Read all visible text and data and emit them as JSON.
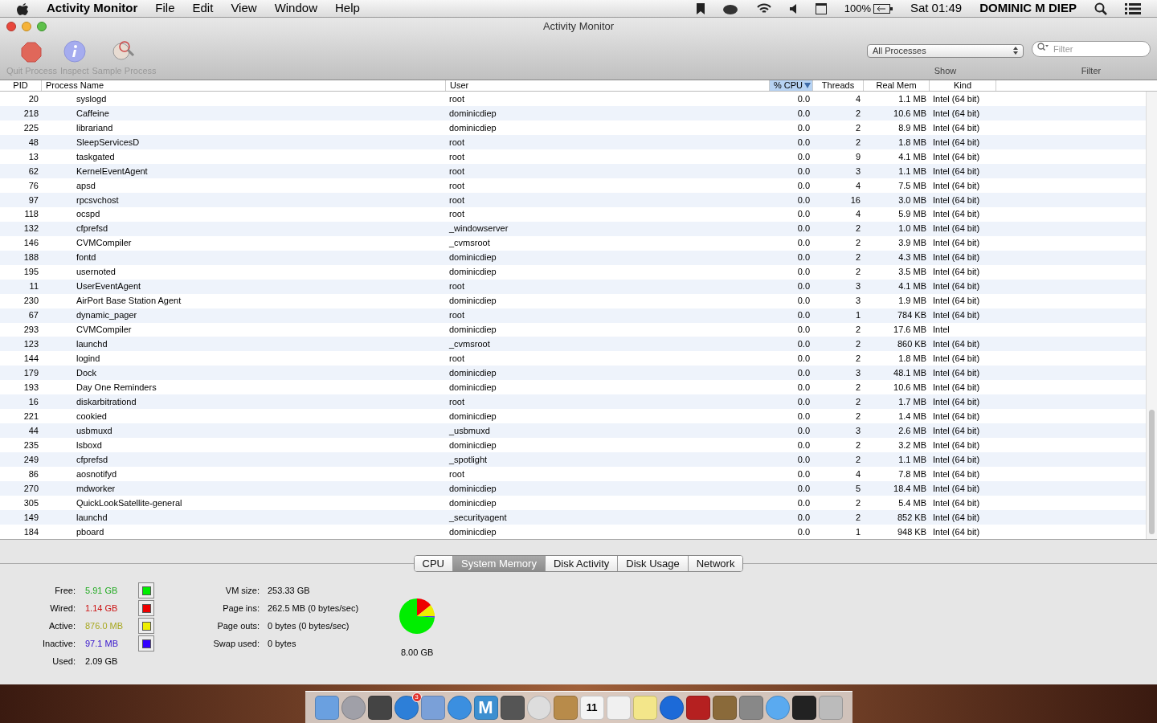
{
  "menu_bar": {
    "app": "Activity Monitor",
    "items": [
      "File",
      "Edit",
      "View",
      "Window",
      "Help"
    ],
    "battery": "100%",
    "clock": "Sat 01:49",
    "user": "DOMINIC M DIEP"
  },
  "window": {
    "title": "Activity Monitor"
  },
  "toolbar": {
    "buttons": [
      {
        "kind": "quit",
        "label": "Quit Process",
        "disabled": true
      },
      {
        "kind": "inspect",
        "label": "Inspect",
        "disabled": true
      },
      {
        "kind": "sample",
        "label": "Sample Process",
        "disabled": true
      }
    ],
    "show": {
      "value": "All Processes",
      "label": "Show"
    },
    "filter": {
      "placeholder": "Filter",
      "label": "Filter"
    }
  },
  "table": {
    "columns": [
      {
        "label": "PID",
        "sorted": false
      },
      {
        "label": "Process Name",
        "sorted": false
      },
      {
        "label": "User",
        "sorted": false
      },
      {
        "label": "% CPU",
        "sorted": true
      },
      {
        "label": "Threads",
        "sorted": false
      },
      {
        "label": "Real Mem",
        "sorted": false
      },
      {
        "label": "Kind",
        "sorted": false
      }
    ],
    "rows": [
      [
        "20",
        "syslogd",
        "root",
        "0.0",
        "4",
        "1.1 MB",
        "Intel (64 bit)"
      ],
      [
        "218",
        "Caffeine",
        "dominicdiep",
        "0.0",
        "2",
        "10.6 MB",
        "Intel (64 bit)"
      ],
      [
        "225",
        "librariand",
        "dominicdiep",
        "0.0",
        "2",
        "8.9 MB",
        "Intel (64 bit)"
      ],
      [
        "48",
        "SleepServicesD",
        "root",
        "0.0",
        "2",
        "1.8 MB",
        "Intel (64 bit)"
      ],
      [
        "13",
        "taskgated",
        "root",
        "0.0",
        "9",
        "4.1 MB",
        "Intel (64 bit)"
      ],
      [
        "62",
        "KernelEventAgent",
        "root",
        "0.0",
        "3",
        "1.1 MB",
        "Intel (64 bit)"
      ],
      [
        "76",
        "apsd",
        "root",
        "0.0",
        "4",
        "7.5 MB",
        "Intel (64 bit)"
      ],
      [
        "97",
        "rpcsvchost",
        "root",
        "0.0",
        "16",
        "3.0 MB",
        "Intel (64 bit)"
      ],
      [
        "118",
        "ocspd",
        "root",
        "0.0",
        "4",
        "5.9 MB",
        "Intel (64 bit)"
      ],
      [
        "132",
        "cfprefsd",
        "_windowserver",
        "0.0",
        "2",
        "1.0 MB",
        "Intel (64 bit)"
      ],
      [
        "146",
        "CVMCompiler",
        "_cvmsroot",
        "0.0",
        "2",
        "3.9 MB",
        "Intel (64 bit)"
      ],
      [
        "188",
        "fontd",
        "dominicdiep",
        "0.0",
        "2",
        "4.3 MB",
        "Intel (64 bit)"
      ],
      [
        "195",
        "usernoted",
        "dominicdiep",
        "0.0",
        "2",
        "3.5 MB",
        "Intel (64 bit)"
      ],
      [
        "11",
        "UserEventAgent",
        "root",
        "0.0",
        "3",
        "4.1 MB",
        "Intel (64 bit)"
      ],
      [
        "230",
        "AirPort Base Station Agent",
        "dominicdiep",
        "0.0",
        "3",
        "1.9 MB",
        "Intel (64 bit)"
      ],
      [
        "67",
        "dynamic_pager",
        "root",
        "0.0",
        "1",
        "784 KB",
        "Intel (64 bit)"
      ],
      [
        "293",
        "CVMCompiler",
        "dominicdiep",
        "0.0",
        "2",
        "17.6 MB",
        "Intel"
      ],
      [
        "123",
        "launchd",
        "_cvmsroot",
        "0.0",
        "2",
        "860 KB",
        "Intel (64 bit)"
      ],
      [
        "144",
        "logind",
        "root",
        "0.0",
        "2",
        "1.8 MB",
        "Intel (64 bit)"
      ],
      [
        "179",
        "Dock",
        "dominicdiep",
        "0.0",
        "3",
        "48.1 MB",
        "Intel (64 bit)"
      ],
      [
        "193",
        "Day One Reminders",
        "dominicdiep",
        "0.0",
        "2",
        "10.6 MB",
        "Intel (64 bit)"
      ],
      [
        "16",
        "diskarbitrationd",
        "root",
        "0.0",
        "2",
        "1.7 MB",
        "Intel (64 bit)"
      ],
      [
        "221",
        "cookied",
        "dominicdiep",
        "0.0",
        "2",
        "1.4 MB",
        "Intel (64 bit)"
      ],
      [
        "44",
        "usbmuxd",
        "_usbmuxd",
        "0.0",
        "3",
        "2.6 MB",
        "Intel (64 bit)"
      ],
      [
        "235",
        "lsboxd",
        "dominicdiep",
        "0.0",
        "2",
        "3.2 MB",
        "Intel (64 bit)"
      ],
      [
        "249",
        "cfprefsd",
        "_spotlight",
        "0.0",
        "2",
        "1.1 MB",
        "Intel (64 bit)"
      ],
      [
        "86",
        "aosnotifyd",
        "root",
        "0.0",
        "4",
        "7.8 MB",
        "Intel (64 bit)"
      ],
      [
        "270",
        "mdworker",
        "dominicdiep",
        "0.0",
        "5",
        "18.4 MB",
        "Intel (64 bit)"
      ],
      [
        "305",
        "QuickLookSatellite-general",
        "dominicdiep",
        "0.0",
        "2",
        "5.4 MB",
        "Intel (64 bit)"
      ],
      [
        "149",
        "launchd",
        "_securityagent",
        "0.0",
        "2",
        "852 KB",
        "Intel (64 bit)"
      ],
      [
        "184",
        "pboard",
        "dominicdiep",
        "0.0",
        "1",
        "948 KB",
        "Intel (64 bit)"
      ]
    ]
  },
  "tabs": [
    {
      "label": "CPU",
      "selected": false
    },
    {
      "label": "System Memory",
      "selected": true
    },
    {
      "label": "Disk Activity",
      "selected": false
    },
    {
      "label": "Disk Usage",
      "selected": false
    },
    {
      "label": "Network",
      "selected": false
    }
  ],
  "memory": {
    "legend": [
      {
        "label": "Free:",
        "value": "5.91 GB",
        "color": "#00ee00"
      },
      {
        "label": "Wired:",
        "value": "1.14 GB",
        "color": "#ee0000"
      },
      {
        "label": "Active:",
        "value": "876.0 MB",
        "color": "#eeee00"
      },
      {
        "label": "Inactive:",
        "value": "97.1 MB",
        "color": "#3300ff"
      }
    ],
    "used": {
      "label": "Used:",
      "value": "2.09 GB"
    },
    "stats": [
      {
        "label": "VM size:",
        "value": "253.33 GB"
      },
      {
        "label": "Page ins:",
        "value": "262.5 MB (0 bytes/sec)"
      },
      {
        "label": "Page outs:",
        "value": "0 bytes (0 bytes/sec)"
      },
      {
        "label": "Swap used:",
        "value": "0 bytes"
      }
    ],
    "total": "8.00 GB",
    "chart_data": {
      "type": "pie",
      "values": [
        14.2,
        10.9,
        1.2,
        73.7
      ]
    }
  },
  "dock": [
    {
      "kind": "finder"
    },
    {
      "kind": "rocket"
    },
    {
      "kind": "dashboard"
    },
    {
      "kind": "appstore",
      "badge": "3"
    },
    {
      "kind": "bird"
    },
    {
      "kind": "compass"
    },
    {
      "kind": "letter",
      "text": "M"
    },
    {
      "kind": "camera"
    },
    {
      "kind": "chrome"
    },
    {
      "kind": "book"
    },
    {
      "kind": "calendar",
      "text": "11"
    },
    {
      "kind": "list"
    },
    {
      "kind": "notes"
    },
    {
      "kind": "music"
    },
    {
      "kind": "film"
    },
    {
      "kind": "photo"
    },
    {
      "kind": "gear"
    },
    {
      "kind": "chat"
    },
    {
      "kind": "monitor"
    },
    {
      "kind": "trash"
    }
  ]
}
